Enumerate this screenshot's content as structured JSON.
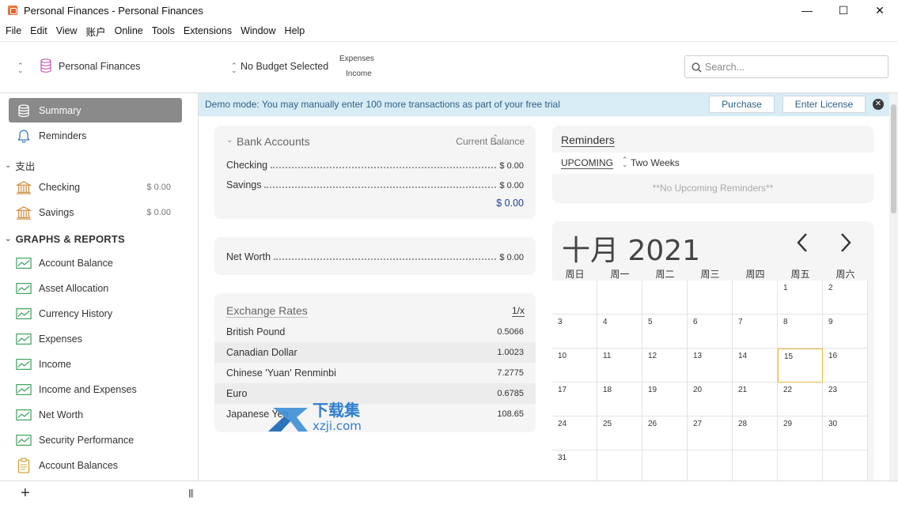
{
  "window": {
    "title": "Personal Finances - Personal Finances",
    "controls": {
      "minimize": "—",
      "maximize": "☐",
      "close": "✕"
    }
  },
  "menu": [
    "File",
    "Edit",
    "View",
    "账户",
    "Online",
    "Tools",
    "Extensions",
    "Window",
    "Help"
  ],
  "toolbar": {
    "account_name": "Personal Finances",
    "budget": "No Budget Selected",
    "expenses": "Expenses",
    "income": "Income",
    "search_placeholder": "Search..."
  },
  "sidebar": {
    "summary": "Summary",
    "reminders": "Reminders",
    "expenses_header": "支出",
    "accounts": [
      {
        "label": "Checking",
        "amount": "$ 0.00"
      },
      {
        "label": "Savings",
        "amount": "$ 0.00"
      }
    ],
    "graphs_header": "GRAPHS & REPORTS",
    "reports": [
      "Account Balance",
      "Asset Allocation",
      "Currency History",
      "Expenses",
      "Income",
      "Income and Expenses",
      "Net Worth",
      "Security Performance",
      "Account Balances"
    ]
  },
  "bottombar": {
    "add": "+",
    "columns": "|||"
  },
  "banner": {
    "text": "Demo mode:  You may manually enter 100 more transactions as part of your free trial",
    "purchase": "Purchase",
    "license": "Enter License",
    "close": "✕"
  },
  "bank": {
    "title": "Bank Accounts",
    "balance_label": "Current Balance",
    "rows": [
      {
        "label": "Checking",
        "amount": "$ 0.00"
      },
      {
        "label": "Savings",
        "amount": "$ 0.00"
      }
    ],
    "total": "$ 0.00"
  },
  "networth": {
    "label": "Net Worth",
    "amount": "$ 0.00"
  },
  "exchange": {
    "title": "Exchange Rates",
    "toggle": "1/x",
    "rows": [
      {
        "name": "British Pound",
        "rate": "0.5066"
      },
      {
        "name": "Canadian Dollar",
        "rate": "1.0023"
      },
      {
        "name": "Chinese 'Yuan' Renminbi",
        "rate": "7.2775"
      },
      {
        "name": "Euro",
        "rate": "0.6785"
      },
      {
        "name": "Japanese Yen",
        "rate": "108.65"
      }
    ]
  },
  "reminders_card": {
    "title": "Reminders",
    "upcoming": "UPCOMING",
    "period": "Two Weeks",
    "empty": "**No Upcoming Reminders**"
  },
  "calendar": {
    "month_title": "十月 2021",
    "prev": "<",
    "next": ">",
    "weekdays": [
      "周日",
      "周一",
      "周二",
      "周三",
      "周四",
      "周五",
      "周六"
    ],
    "leading_blanks": 5,
    "days_in_month": 31,
    "today": 15
  },
  "watermark": {
    "brand": "下载集",
    "site": "xzji.com"
  }
}
